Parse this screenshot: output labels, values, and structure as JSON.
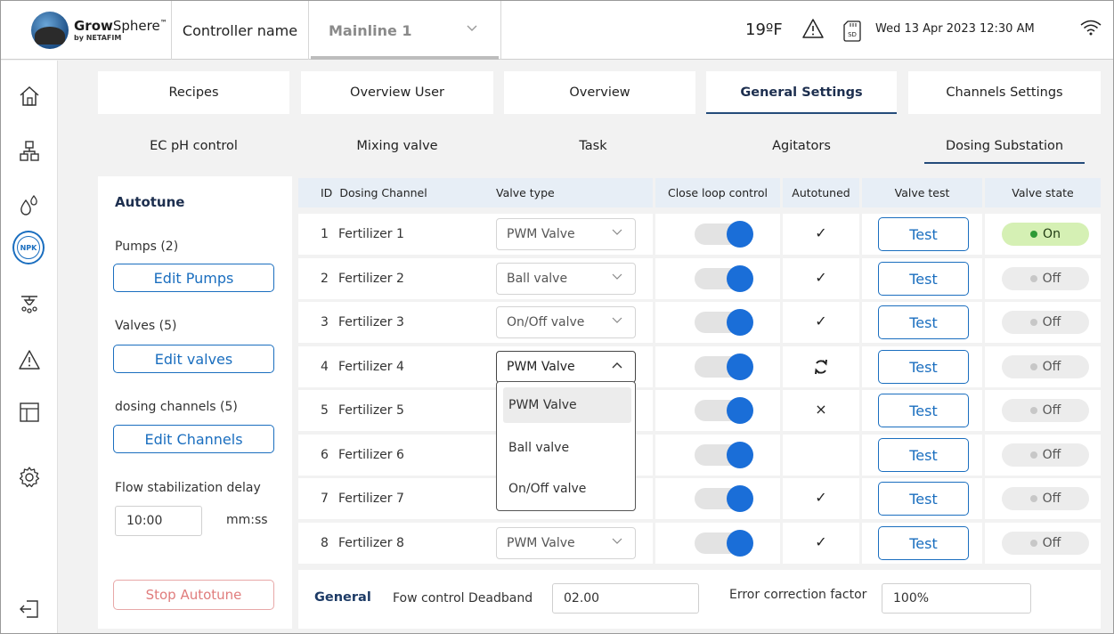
{
  "header": {
    "brand_main": "Grow",
    "brand_lite": "Sphere",
    "brand_tm": "™",
    "brand_sub": "by NETAFIM",
    "controller_label": "Controller name",
    "controller_value": "Mainline 1",
    "temperature": "19ºF",
    "sd_label": "SD",
    "datetime": "Wed 13 Apr 2023  12:30 AM"
  },
  "sidebar": {
    "items": [
      "home-icon",
      "network-icon",
      "drops-icon",
      "npk-icon",
      "sprinkler-icon",
      "alarm-icon",
      "layout-icon",
      "settings-icon",
      "logout-icon"
    ],
    "npk_label": "NPK",
    "active": "npk-icon"
  },
  "tabs": [
    {
      "label": "Recipes"
    },
    {
      "label": "Overview User"
    },
    {
      "label": "Overview"
    },
    {
      "label": "General Settings",
      "active": true
    },
    {
      "label": "Channels Settings"
    }
  ],
  "subtabs": [
    {
      "label": "EC pH control"
    },
    {
      "label": "Mixing valve"
    },
    {
      "label": "Task"
    },
    {
      "label": "Agitators"
    },
    {
      "label": "Dosing Substation",
      "active": true
    }
  ],
  "left": {
    "title": "Autotune",
    "pumps_label": "Pumps (2)",
    "edit_pumps": "Edit Pumps",
    "valves_label": "Valves (5)",
    "edit_valves": "Edit valves",
    "channels_label": "dosing channels  (5)",
    "edit_channels": "Edit Channels",
    "delay_label": "Flow stabilization delay",
    "delay_value": "10:00",
    "delay_unit": "mm:ss",
    "stop": "Stop Autotune"
  },
  "table": {
    "headers": {
      "id": "ID",
      "channel": "Dosing Channel",
      "valve_type": "Valve type",
      "close_loop": "Close loop control",
      "autotuned": "Autotuned",
      "valve_test": "Valve test",
      "valve_state": "Valve state"
    },
    "test_label": "Test",
    "rows": [
      {
        "id": "1",
        "name": "Fertilizer 1",
        "valve": "PWM Valve",
        "autotuned": "✓",
        "state": "On"
      },
      {
        "id": "2",
        "name": "Fertilizer 2",
        "valve": "Ball valve",
        "autotuned": "✓",
        "state": "Off"
      },
      {
        "id": "3",
        "name": "Fertilizer 3",
        "valve": "On/Off valve",
        "autotuned": "✓",
        "state": "Off"
      },
      {
        "id": "4",
        "name": "Fertilizer 4",
        "valve": "PWM Valve",
        "autotuned": "↻",
        "state": "Off"
      },
      {
        "id": "5",
        "name": "Fertilizer 5",
        "valve": "",
        "autotuned": "×",
        "state": "Off"
      },
      {
        "id": "6",
        "name": "Fertilizer 6",
        "valve": "",
        "autotuned": "",
        "state": "Off"
      },
      {
        "id": "7",
        "name": "Fertilizer 7",
        "valve": "",
        "autotuned": "✓",
        "state": "Off"
      },
      {
        "id": "8",
        "name": "Fertilizer 8",
        "valve": "PWM Valve",
        "autotuned": "✓",
        "state": "Off"
      }
    ],
    "dropdown_options": [
      "PWM Valve",
      "Ball valve",
      "On/Off valve"
    ]
  },
  "footer": {
    "title": "General",
    "deadband_label": "Fow control Deadband",
    "deadband_value": "02.00",
    "error_label": "Error correction factor",
    "error_value": "100%"
  },
  "colors": {
    "accent": "#1a6ebf",
    "toggle_on": "#1a6ed8",
    "state_on_bg": "#d5f0b4",
    "stop_red": "#e07c7c"
  }
}
